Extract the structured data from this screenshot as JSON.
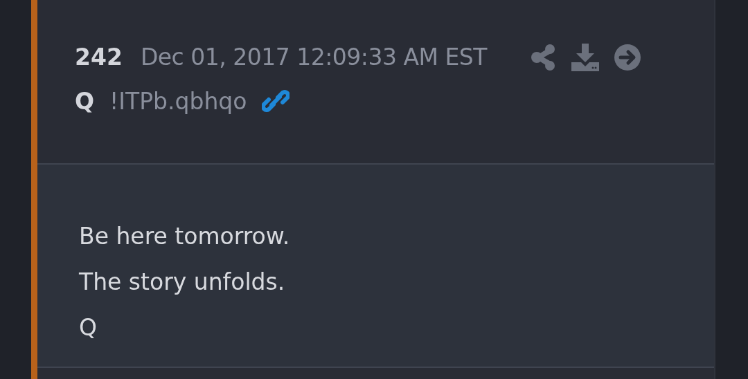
{
  "post": {
    "number": "242",
    "timestamp": "Dec 01, 2017 12:09:33 AM EST",
    "author": "Q",
    "tripcode": "!ITPb.qbhqo",
    "lines": [
      "Be here tomorrow.",
      "The story unfolds.",
      "Q"
    ]
  }
}
